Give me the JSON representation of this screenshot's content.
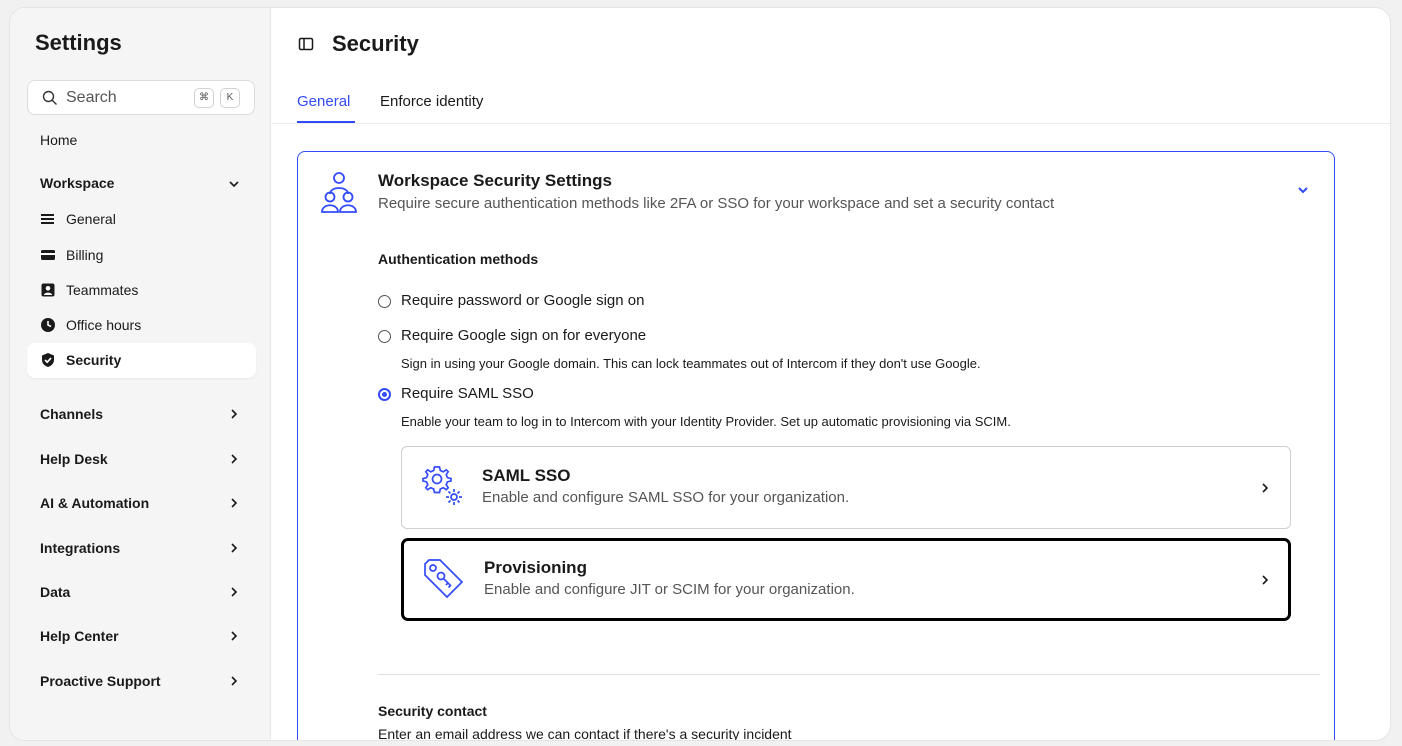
{
  "sidebar": {
    "title": "Settings",
    "search": {
      "placeholder": "Search",
      "shortcut_cmd": "⌘",
      "shortcut_key": "K"
    },
    "home": "Home",
    "workspace": {
      "label": "Workspace",
      "items": [
        {
          "label": "General",
          "icon": "menu-lines-icon"
        },
        {
          "label": "Billing",
          "icon": "credit-card-icon"
        },
        {
          "label": "Teammates",
          "icon": "person-card-icon"
        },
        {
          "label": "Office hours",
          "icon": "clock-icon"
        },
        {
          "label": "Security",
          "icon": "shield-check-icon",
          "active": true
        }
      ]
    },
    "sections": [
      "Channels",
      "Help Desk",
      "AI & Automation",
      "Integrations",
      "Data",
      "Help Center",
      "Proactive Support"
    ]
  },
  "header": {
    "title": "Security",
    "panel_icon": "sidebar-panel-icon"
  },
  "tabs": [
    {
      "label": "General",
      "active": true
    },
    {
      "label": "Enforce identity",
      "active": false
    }
  ],
  "card": {
    "title": "Workspace Security Settings",
    "subtitle": "Require secure authentication methods like 2FA or SSO for your workspace and set a security contact",
    "auth_title": "Authentication methods",
    "options": [
      {
        "label": "Require password or Google sign on",
        "checked": false
      },
      {
        "label": "Require Google sign on for everyone",
        "checked": false,
        "desc": "Sign in using your Google domain. This can lock teammates out of Intercom if they don't use Google."
      },
      {
        "label": "Require SAML SSO",
        "checked": true,
        "desc": "Enable your team to log in to Intercom with your Identity Provider. Set up automatic provisioning via SCIM."
      }
    ],
    "links": [
      {
        "title": "SAML SSO",
        "subtitle": "Enable and configure SAML SSO for your organization.",
        "icon": "gears-icon"
      },
      {
        "title": "Provisioning",
        "subtitle": "Enable and configure JIT or SCIM for your organization.",
        "icon": "tag-key-icon"
      }
    ],
    "security_contact": {
      "title": "Security contact",
      "desc": "Enter an email address we can contact if there's a security incident"
    }
  },
  "colors": {
    "accent": "#334bfa",
    "focus_outline": "#000000"
  }
}
